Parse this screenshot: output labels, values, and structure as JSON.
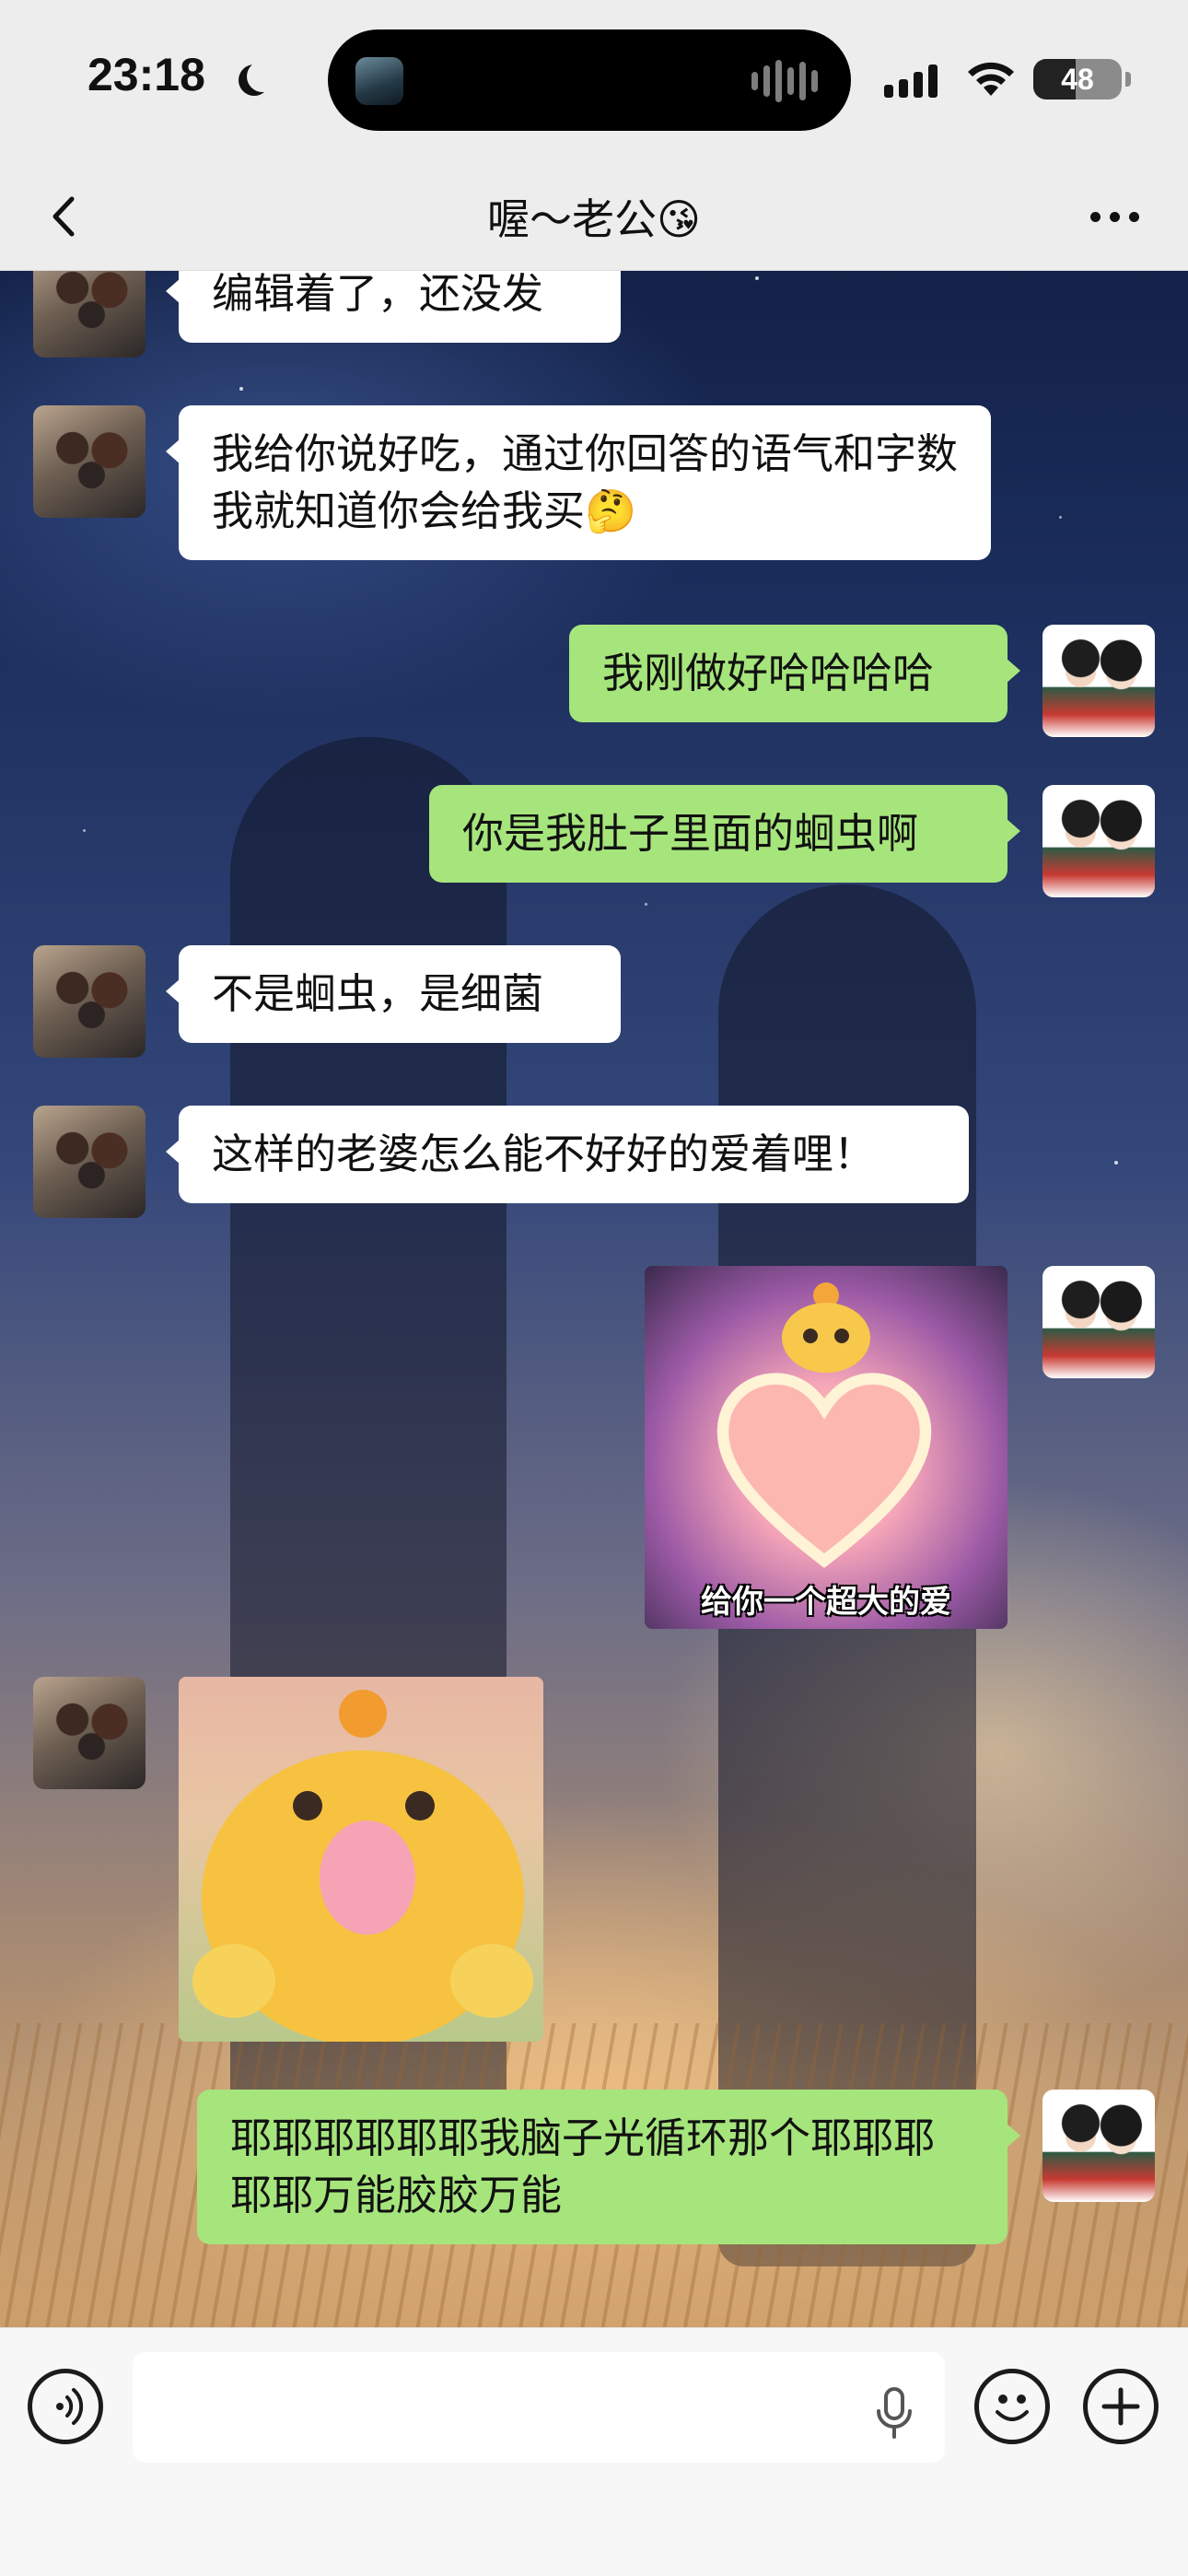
{
  "status_bar": {
    "time": "23:18",
    "battery": "48",
    "battery_level": 0.48
  },
  "nav": {
    "title": "喔～老公😘"
  },
  "messages": [
    {
      "side": "in",
      "type": "text",
      "text": "编辑着了，还没发"
    },
    {
      "side": "in",
      "type": "text",
      "text": "我给你说好吃，通过你回答的语气和字数我就知道你会给我买🤔"
    },
    {
      "side": "out",
      "type": "text",
      "text": "我刚做好哈哈哈哈"
    },
    {
      "side": "out",
      "type": "text",
      "text": "你是我肚子里面的蛔虫啊"
    },
    {
      "side": "in",
      "type": "text",
      "text": "不是蛔虫，是细菌"
    },
    {
      "side": "in",
      "type": "text",
      "text": "这样的老婆怎么能不好好的爱着哩！"
    },
    {
      "side": "out",
      "type": "sticker",
      "caption": "给你一个超大的爱"
    },
    {
      "side": "in",
      "type": "sticker"
    },
    {
      "side": "out",
      "type": "text",
      "text": "耶耶耶耶耶耶我脑子光循环那个耶耶耶耶耶万能胶胶万能"
    }
  ],
  "input": {
    "value": "",
    "placeholder": ""
  },
  "icons": {
    "back": "chevron-left-icon",
    "more": "more-dots-icon",
    "voice": "voice-icon",
    "mic": "microphone-icon",
    "emoji": "emoji-icon",
    "plus": "plus-icon",
    "moon": "moon-icon"
  },
  "colors": {
    "incoming_bubble": "#ffffff",
    "outgoing_bubble": "#a6e57c",
    "bar_bg": "#ededed"
  }
}
